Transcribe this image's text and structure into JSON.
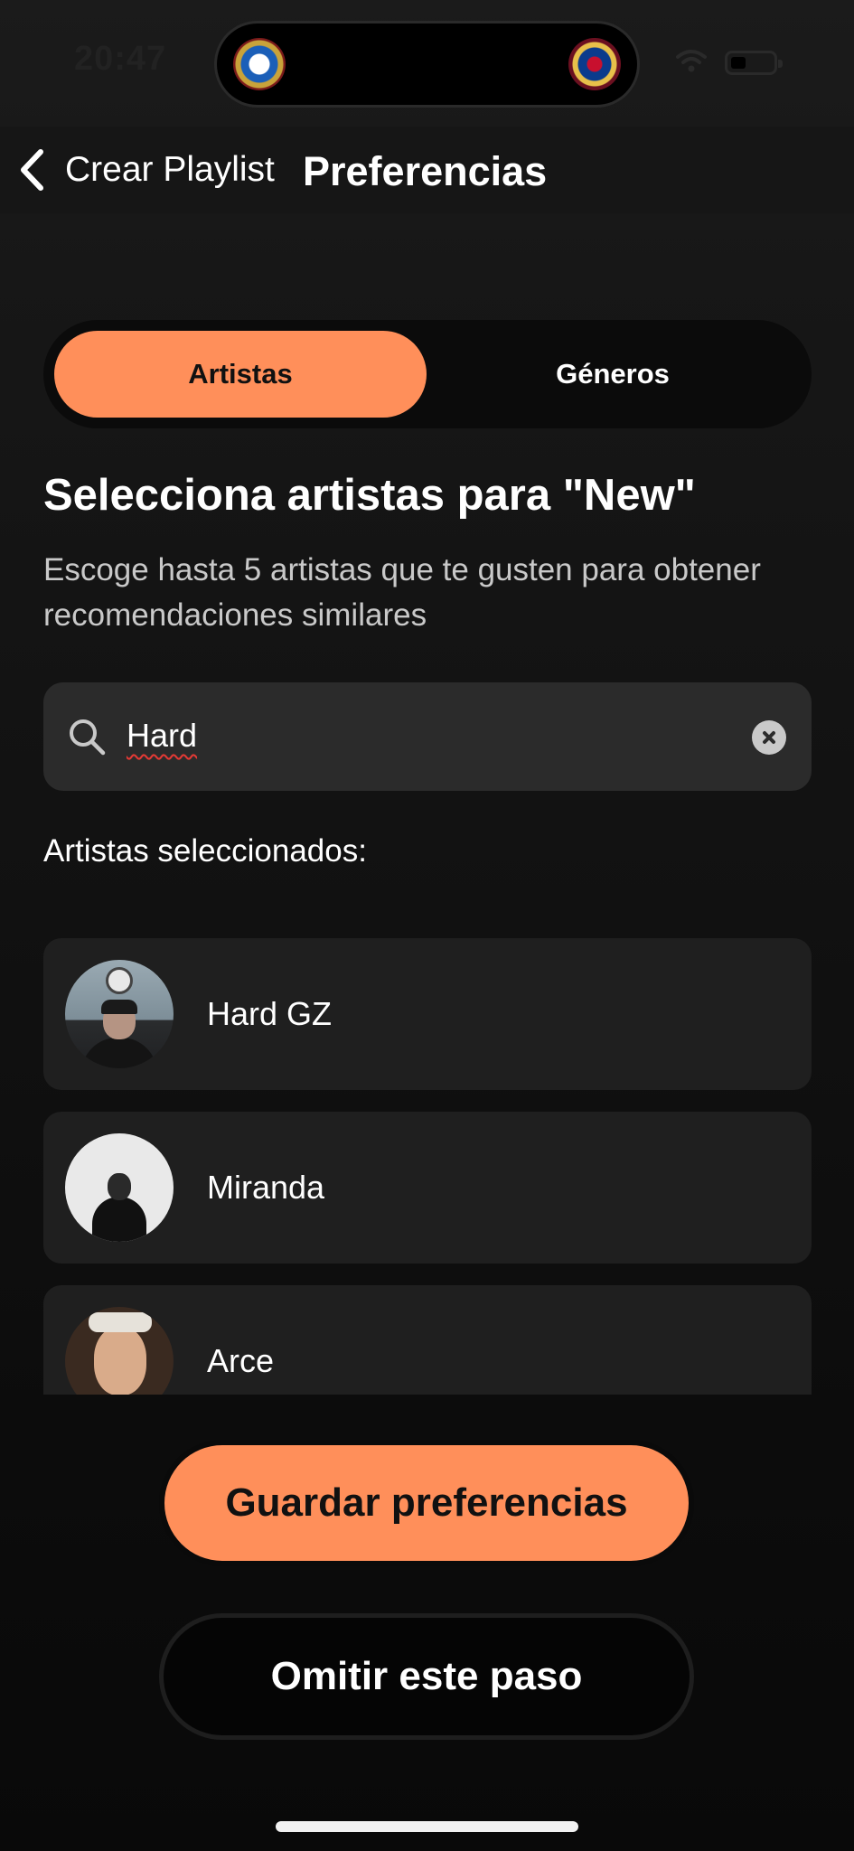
{
  "status_bar": {
    "time": "20:47"
  },
  "header": {
    "back_label": "Crear Playlist",
    "title": "Preferencias"
  },
  "tabs": [
    {
      "label": "Artistas",
      "active": true
    },
    {
      "label": "Géneros",
      "active": false
    }
  ],
  "section": {
    "title": "Selecciona artistas para \"New\"",
    "subtitle": "Escoge hasta 5 artistas que te gusten para obtener recomendaciones similares"
  },
  "search": {
    "value": "Hard",
    "icon": "search-icon",
    "clear_icon": "clear-icon"
  },
  "selected": {
    "label": "Artistas seleccionados:",
    "artists": [
      {
        "name": "Hard GZ"
      },
      {
        "name": "Miranda"
      },
      {
        "name": "Arce"
      }
    ]
  },
  "actions": {
    "save_label": "Guardar preferencias",
    "skip_label": "Omitir este paso"
  },
  "colors": {
    "accent": "#ff8f5a",
    "background": "#101010",
    "card": "#1f1f1f",
    "search_bg": "#2b2b2b"
  }
}
